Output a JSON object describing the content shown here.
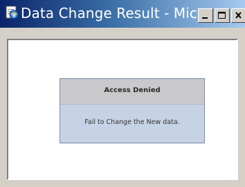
{
  "window": {
    "title": "Data Change Result - Mic..."
  },
  "dialog": {
    "title": "Access Denied",
    "message": "Fail to Change the New data."
  },
  "icons": {
    "app": "ie-document-icon",
    "minimize": "minimize-icon",
    "maximize": "maximize-icon",
    "close": "close-icon"
  },
  "colors": {
    "titlebar_start": "#0a246a",
    "titlebar_end": "#a6caf0",
    "dialog_header": "#c9c9cb",
    "dialog_body": "#c6d3e6"
  }
}
